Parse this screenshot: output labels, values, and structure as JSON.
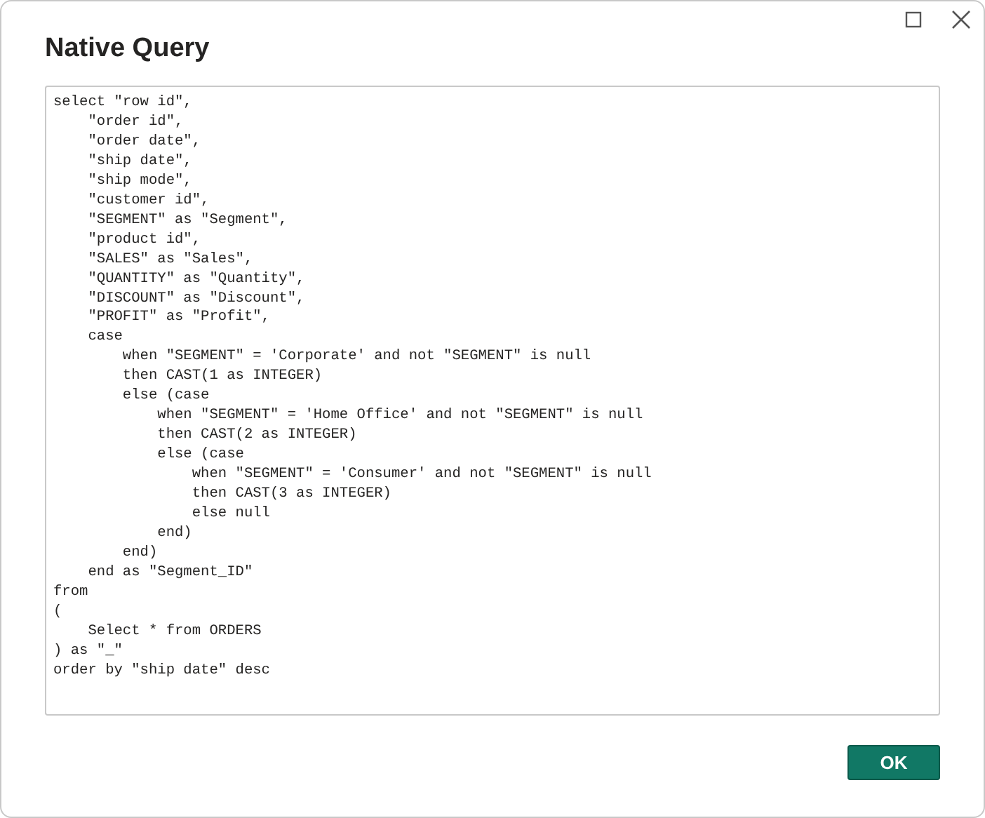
{
  "window": {
    "title": "Native Query"
  },
  "query": "select \"row id\",\n    \"order id\",\n    \"order date\",\n    \"ship date\",\n    \"ship mode\",\n    \"customer id\",\n    \"SEGMENT\" as \"Segment\",\n    \"product id\",\n    \"SALES\" as \"Sales\",\n    \"QUANTITY\" as \"Quantity\",\n    \"DISCOUNT\" as \"Discount\",\n    \"PROFIT\" as \"Profit\",\n    case\n        when \"SEGMENT\" = 'Corporate' and not \"SEGMENT\" is null\n        then CAST(1 as INTEGER)\n        else (case\n            when \"SEGMENT\" = 'Home Office' and not \"SEGMENT\" is null\n            then CAST(2 as INTEGER)\n            else (case\n                when \"SEGMENT\" = 'Consumer' and not \"SEGMENT\" is null\n                then CAST(3 as INTEGER)\n                else null\n            end)\n        end)\n    end as \"Segment_ID\"\nfrom\n(\n    Select * from ORDERS\n) as \"_\"\norder by \"ship date\" desc",
  "buttons": [
    {
      "label": "OK"
    }
  ]
}
